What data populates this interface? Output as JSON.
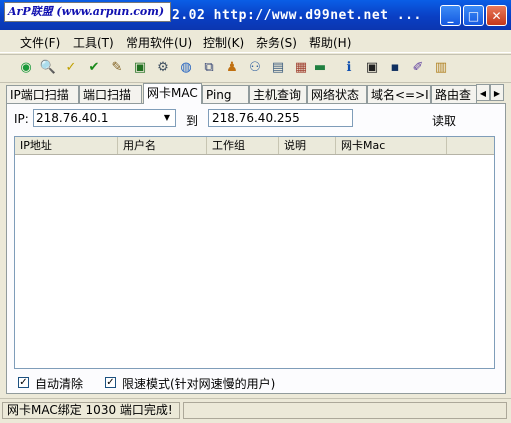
{
  "titlebar": {
    "logo_text": "ArP联盟 (www.arpun.com)",
    "title": "2.02   http://www.d99net.net ...",
    "minimize_label": "_",
    "maximize_label": "□",
    "close_label": "✕"
  },
  "menu": [
    {
      "label": "文件(F)"
    },
    {
      "label": "工具(T)"
    },
    {
      "label": "常用软件(U)"
    },
    {
      "label": "控制(K)"
    },
    {
      "label": "杂务(S)"
    },
    {
      "label": "帮助(H)"
    }
  ],
  "toolbar": [
    {
      "icon": "◉",
      "color": "#1a9a3a"
    },
    {
      "icon": "🔍",
      "color": "#000000"
    },
    {
      "icon": "✓",
      "color": "#c0a000"
    },
    {
      "icon": "✔",
      "color": "#1a8a1a"
    },
    {
      "icon": "✎",
      "color": "#806020"
    },
    {
      "icon": "▣",
      "color": "#207020"
    },
    {
      "icon": "⚙",
      "color": "#405060"
    },
    {
      "icon": "◍",
      "color": "#2060c0"
    },
    {
      "icon": "⧉",
      "color": "#304070"
    },
    {
      "icon": "♟",
      "color": "#c07010"
    },
    {
      "icon": "⚇",
      "color": "#3060a0"
    },
    {
      "icon": "▤",
      "color": "#406080"
    },
    {
      "icon": "▦",
      "color": "#a04030"
    },
    {
      "icon": "▬",
      "color": "#208040"
    },
    {
      "icon": "ℹ",
      "color": "#1050b0"
    },
    {
      "icon": "▣",
      "color": "#202020"
    },
    {
      "icon": "▪",
      "color": "#103060"
    },
    {
      "icon": "✐",
      "color": "#6040a0"
    },
    {
      "icon": "▥",
      "color": "#b08020"
    }
  ],
  "tabs": [
    {
      "label": "IP端口扫描"
    },
    {
      "label": "端口扫描"
    },
    {
      "label": "网卡MAC"
    },
    {
      "label": "Ping"
    },
    {
      "label": "主机查询"
    },
    {
      "label": "网络状态"
    },
    {
      "label": "域名<=>IP"
    },
    {
      "label": "路由查"
    }
  ],
  "active_tab": "网卡MAC",
  "form": {
    "ip_label": "IP:",
    "ip_start": "218.76.40.1",
    "to_label": "到",
    "ip_end": "218.76.40.255",
    "read_button": "读取"
  },
  "table": {
    "columns": [
      "IP地址",
      "用户名",
      "工作组",
      "说明",
      "网卡Mac"
    ],
    "rows": []
  },
  "options": {
    "auto_clear_label": "自动清除",
    "auto_clear_checked": true,
    "slow_mode_label": "限速模式(针对网速慢的用户)",
    "slow_mode_checked": true
  },
  "status": {
    "message": "网卡MAC绑定 1030 端口完成!"
  },
  "colors": {
    "titlebar": "#0a3fc4",
    "panel_bg": "#ece9d8",
    "close_button": "#c4381c"
  }
}
